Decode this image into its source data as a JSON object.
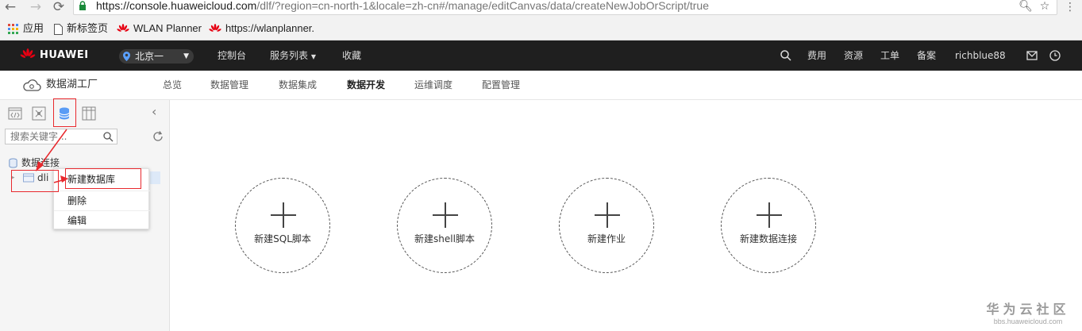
{
  "browser": {
    "url_host": "https://console.huaweicloud.com",
    "url_path": "/dlf/?region=cn-north-1&locale=zh-cn#/manage/editCanvas/data/createNewJobOrScript/true",
    "bookmarks": [
      "应用",
      "新标签页",
      "WLAN Planner",
      "https://wlanplanner."
    ]
  },
  "header": {
    "logo_text": "HUAWEI",
    "region": "北京一",
    "nav": [
      "控制台",
      "服务列表",
      "收藏"
    ],
    "right_links": [
      "费用",
      "资源",
      "工单",
      "备案"
    ],
    "username": "richblue88"
  },
  "subnav": {
    "product": "数据湖工厂",
    "items": [
      "总览",
      "数据管理",
      "数据集成",
      "数据开发",
      "运维调度",
      "配置管理"
    ],
    "active": "数据开发"
  },
  "left_panel": {
    "search_placeholder": "搜索关键字...",
    "tree_root": "数据连接",
    "tree_node": "dli",
    "context_menu": [
      "新建数据库",
      "删除",
      "编辑"
    ]
  },
  "canvas": {
    "actions": [
      "新建SQL脚本",
      "新建shell脚本",
      "新建作业",
      "新建数据连接"
    ]
  },
  "watermark": {
    "line1": "华为云社区",
    "line2": "bbs.huaweicloud.com"
  },
  "colors": {
    "header_bg": "#1f1f1f",
    "annotation_red": "#e8292e",
    "huawei_red": "#e60012"
  },
  "icons": [
    "back-icon",
    "forward-icon",
    "reload-icon",
    "lock-icon",
    "zoom-icon",
    "star-icon",
    "menu-icon",
    "apps-icon",
    "page-icon",
    "huawei-logo-icon",
    "location-pin-icon",
    "search-icon",
    "mail-icon",
    "clock-icon",
    "cloud-icon",
    "script-icon",
    "job-icon",
    "database-icon",
    "table-icon",
    "collapse-icon",
    "refresh-icon"
  ]
}
